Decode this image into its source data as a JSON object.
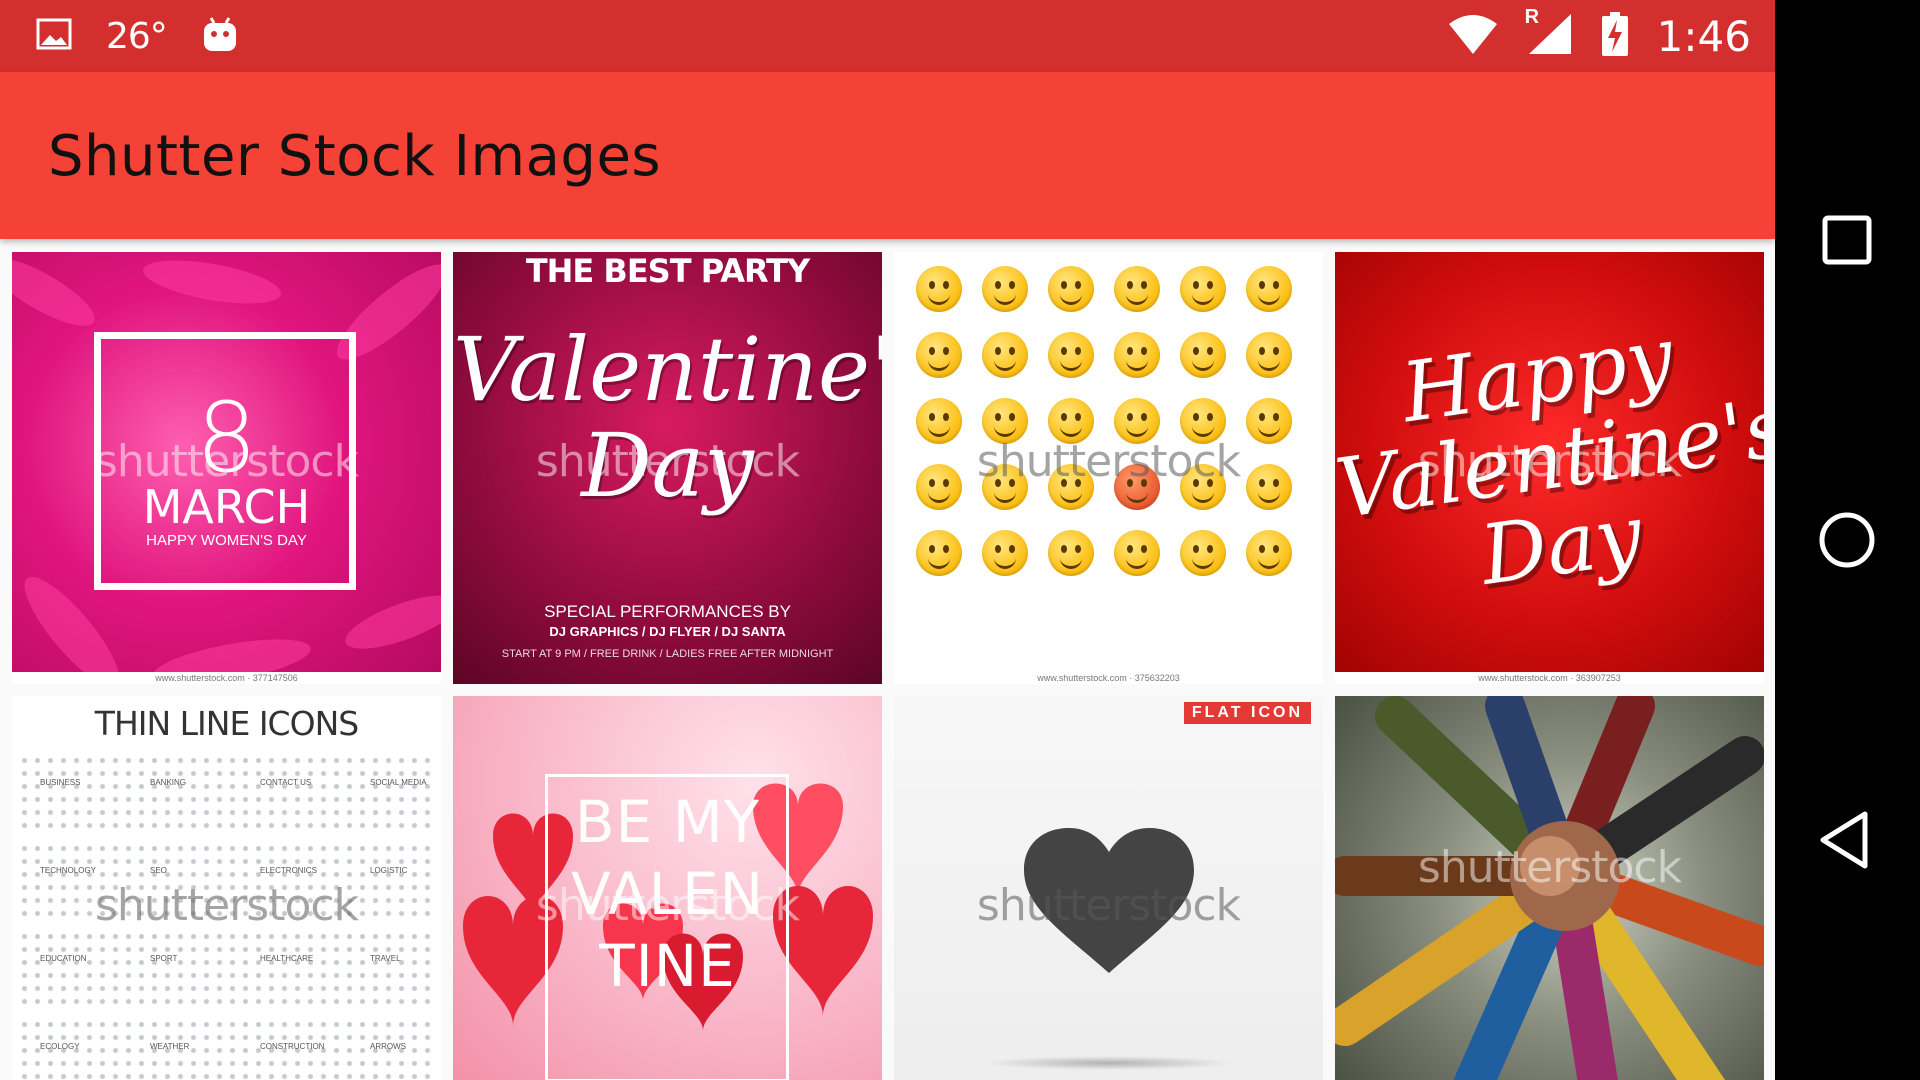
{
  "status_bar": {
    "temperature": "26°",
    "time": "1:46",
    "roaming": "R",
    "icons": [
      "image-icon",
      "android-icon",
      "wifi-icon",
      "signal-icon",
      "battery-charging-icon"
    ]
  },
  "app_bar": {
    "title": "Shutter Stock Images",
    "color": "#f44336"
  },
  "colors": {
    "status_bar": "#d32f2f",
    "app_bar": "#f44336",
    "nav_bar": "#000000"
  },
  "watermark": "shutterstock",
  "images": [
    {
      "caption": "www.shutterstock.com · 377147506",
      "number": "8",
      "title": "MARCH",
      "subtitle": "HAPPY WOMEN'S DAY"
    },
    {
      "caption": "",
      "header": "THE BEST PARTY",
      "script": "Valentine's Day",
      "line1": "SPECIAL PERFORMANCES BY",
      "line2": "DJ GRAPHICS / DJ FLYER / DJ SANTA",
      "line3": "START AT 9 PM / FREE DRINK / LADIES FREE AFTER MIDNIGHT"
    },
    {
      "caption": "www.shutterstock.com · 375632203"
    },
    {
      "caption": "www.shutterstock.com · 363907253",
      "script": "Happy Valentine's Day"
    },
    {
      "title": "THIN LINE ICONS",
      "categories": [
        "BUSINESS",
        "BANKING",
        "CONTACT US",
        "SOCIAL MEDIA",
        "TECHNOLOGY",
        "SEO",
        "ELECTRONICS",
        "LOGISTIC",
        "EDUCATION",
        "SPORT",
        "HEALTHCARE",
        "TRAVEL",
        "ECOLOGY",
        "WEATHER",
        "CONSTRUCTION",
        "ARROWS"
      ]
    },
    {
      "line1": "BE MY",
      "line2": "VALEN",
      "line3": "TINE"
    },
    {
      "badge": "FLAT ICON"
    },
    {}
  ],
  "nav": {
    "recents": "recents-icon",
    "home": "home-icon",
    "back": "back-icon"
  }
}
